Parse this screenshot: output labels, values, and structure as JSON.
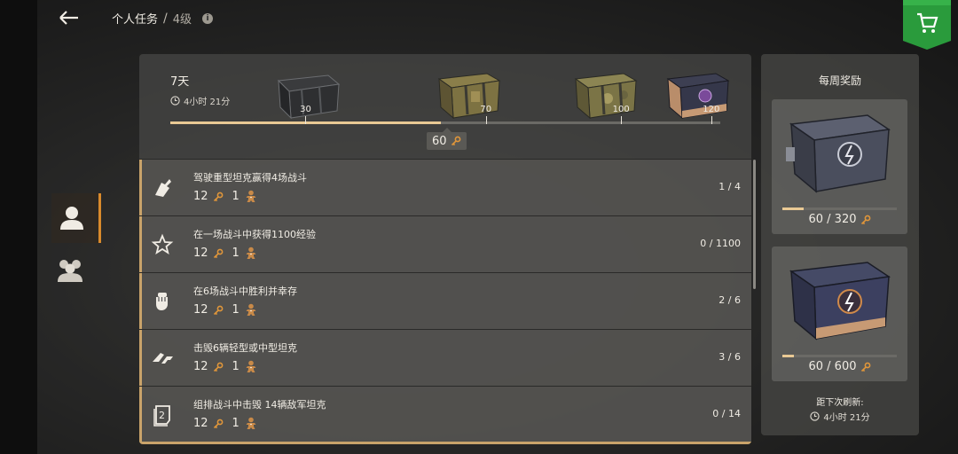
{
  "header": {
    "title": "个人任务",
    "separator": "/",
    "level": "4级"
  },
  "progress": {
    "days": "7天",
    "time_left": "4小时 21分",
    "current": "60",
    "current_value": 60,
    "max_value": 120,
    "milestones": [
      {
        "value": "30",
        "num": 30
      },
      {
        "value": "70",
        "num": 70
      },
      {
        "value": "100",
        "num": 100
      },
      {
        "value": "120",
        "num": 120
      }
    ]
  },
  "tasks": [
    {
      "name": "驾驶重型坦克赢得4场战斗",
      "reward_keys": "12",
      "reward_items": "1",
      "progress": "1 / 4",
      "icon": "heavy-tank-icon"
    },
    {
      "name": "在一场战斗中获得1100经验",
      "reward_keys": "12",
      "reward_items": "1",
      "progress": "0 / 1100",
      "icon": "star-icon"
    },
    {
      "name": "在6场战斗中胜利并幸存",
      "reward_keys": "12",
      "reward_items": "1",
      "progress": "2 / 6",
      "icon": "fist-icon"
    },
    {
      "name": "击毁6辆轻型或中型坦克",
      "reward_keys": "12",
      "reward_items": "1",
      "progress": "3 / 6",
      "icon": "light-tank-icon"
    },
    {
      "name": "组排战斗中击毁 14辆敌军坦克",
      "reward_keys": "12",
      "reward_items": "1",
      "progress": "0 / 14",
      "icon": "platoon-icon"
    }
  ],
  "weekly": {
    "title": "每周奖励",
    "rewards": [
      {
        "progress": "60 / 320",
        "fraction": 0.1875
      },
      {
        "progress": "60 / 600",
        "fraction": 0.1
      }
    ],
    "refresh_label": "距下次刷新:",
    "refresh_time": "4小时 21分"
  },
  "colors": {
    "accent": "#d98a2c",
    "gold": "#e9c994",
    "cart_green": "#2a9b3c"
  }
}
